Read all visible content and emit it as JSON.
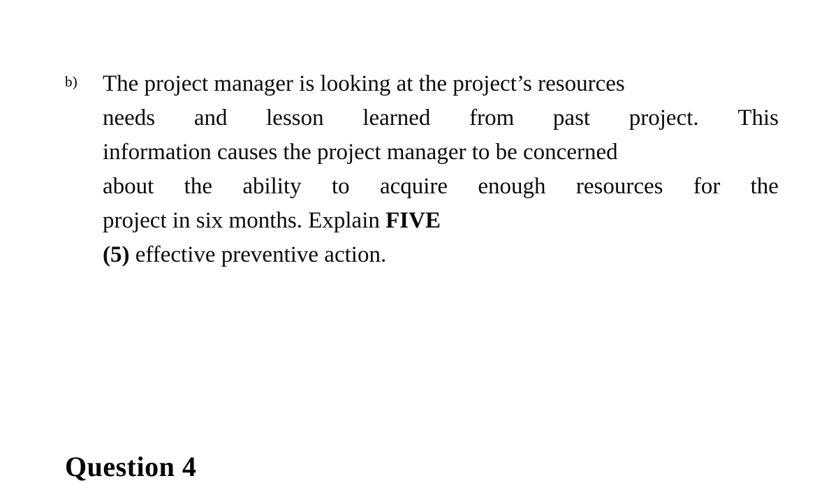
{
  "document": {
    "background_color": "#ffffff",
    "text_color": "#000000"
  },
  "question_block": {
    "marker": "b)",
    "full_text": "The project manager is looking at the project’s resources needs and lesson learned from past project. This information causes the project manager to be concerned about the ability to acquire enough resources for the project in six months. Explain FIVE (5) effective preventive action.",
    "lines": [
      {
        "id": "line-1",
        "justified": false,
        "text": "The project manager is looking at the project’s resources",
        "words": [
          "The",
          "project",
          "manager",
          "is",
          "looking",
          "at",
          "the",
          "project’s",
          "resources"
        ]
      },
      {
        "id": "line-2",
        "justified": true,
        "text": "needs and lesson learned from past project. This",
        "words": [
          "needs",
          "and",
          "lesson",
          "learned",
          "from",
          "past",
          "project.",
          "This"
        ]
      },
      {
        "id": "line-3",
        "justified": false,
        "text": "information causes the project manager to be concerned",
        "words": [
          "information",
          "causes",
          "the",
          "project",
          "manager",
          "to",
          "be",
          "concerned"
        ]
      },
      {
        "id": "line-4",
        "justified": true,
        "text": "about the ability to acquire enough resources for the",
        "words": [
          "about",
          "the",
          "ability",
          "to",
          "acquire",
          "enough",
          "resources",
          "for",
          "the"
        ]
      },
      {
        "id": "line-5",
        "justified": false,
        "text": "project in six months. Explain FIVE",
        "segments": [
          {
            "text": "project in six months. Explain ",
            "bold": false
          },
          {
            "text": "FIVE",
            "bold": true
          }
        ]
      },
      {
        "id": "line-6",
        "justified": false,
        "text": "(5) effective preventive action.",
        "segments": [
          {
            "text": "(5)",
            "bold": true
          },
          {
            "text": " effective preventive action.",
            "bold": false
          }
        ]
      }
    ]
  },
  "next_heading": {
    "text": "Question 4",
    "clipped": "true"
  }
}
